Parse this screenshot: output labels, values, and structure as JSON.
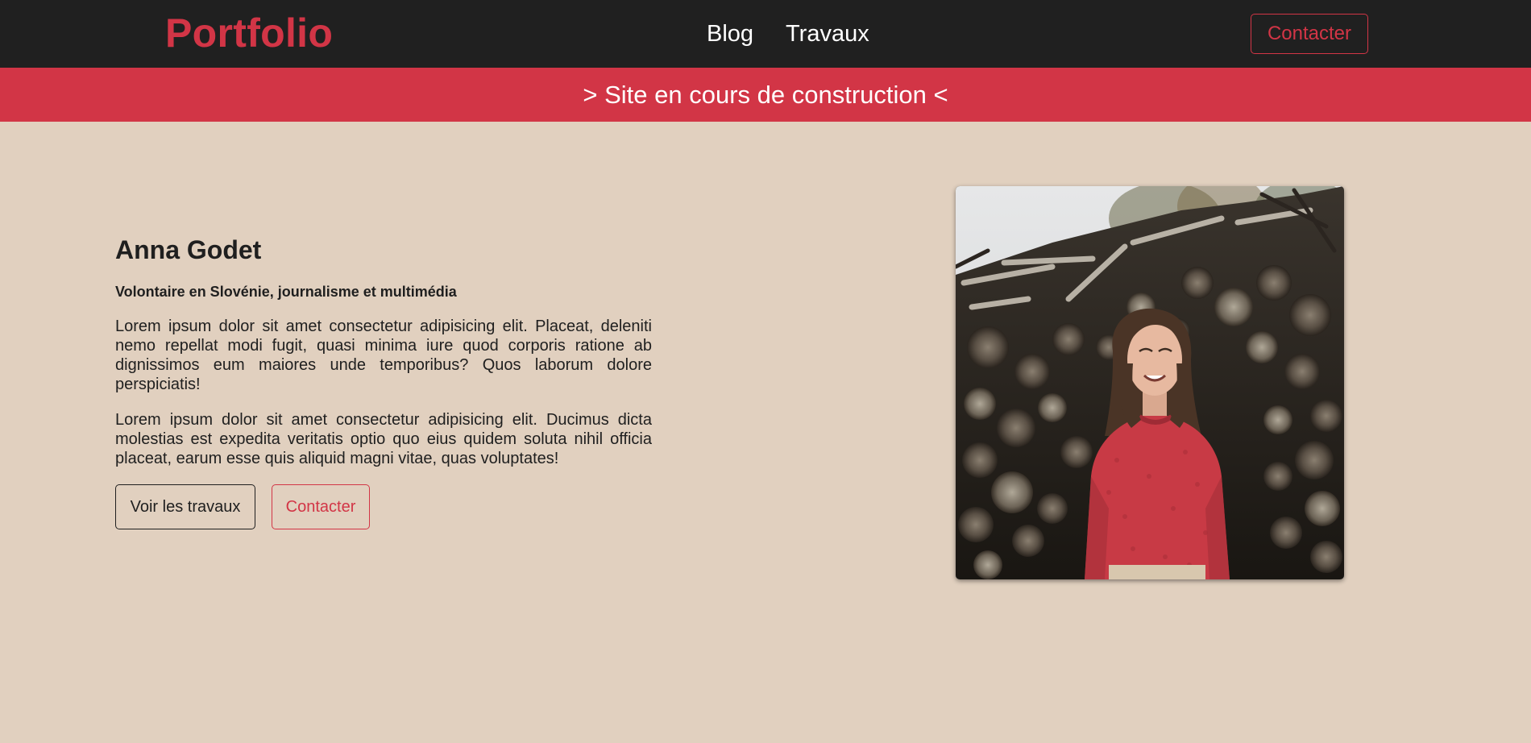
{
  "header": {
    "brand": "Portfolio",
    "nav": [
      {
        "label": "Blog"
      },
      {
        "label": "Travaux"
      }
    ],
    "contact_label": "Contacter"
  },
  "banner": {
    "text": "> Site en cours de construction <"
  },
  "intro": {
    "name": "Anna Godet",
    "subtitle": "Volontaire en Slovénie, journalisme et multimédia",
    "paragraphs": [
      "Lorem ipsum dolor sit amet consectetur adipisicing elit. Placeat, deleniti nemo repellat modi fugit, quasi minima iure quod corporis ratione ab dignissimos eum maiores unde temporibus? Quos laborum dolore perspiciatis!",
      "Lorem ipsum dolor sit amet consectetur adipisicing elit. Ducimus dicta molestias est expedita veritatis optio quo eius quidem soluta nihil officia placeat, earum esse quis aliquid magni vitae, quas voluptates!"
    ],
    "buttons": {
      "works": "Voir les travaux",
      "contact": "Contacter"
    }
  },
  "portrait": {
    "subject": "woman in red sweater in front of stacked firewood"
  },
  "colors": {
    "accent": "#d23546",
    "header_bg": "#202020",
    "page_bg": "#e1d0bf"
  }
}
